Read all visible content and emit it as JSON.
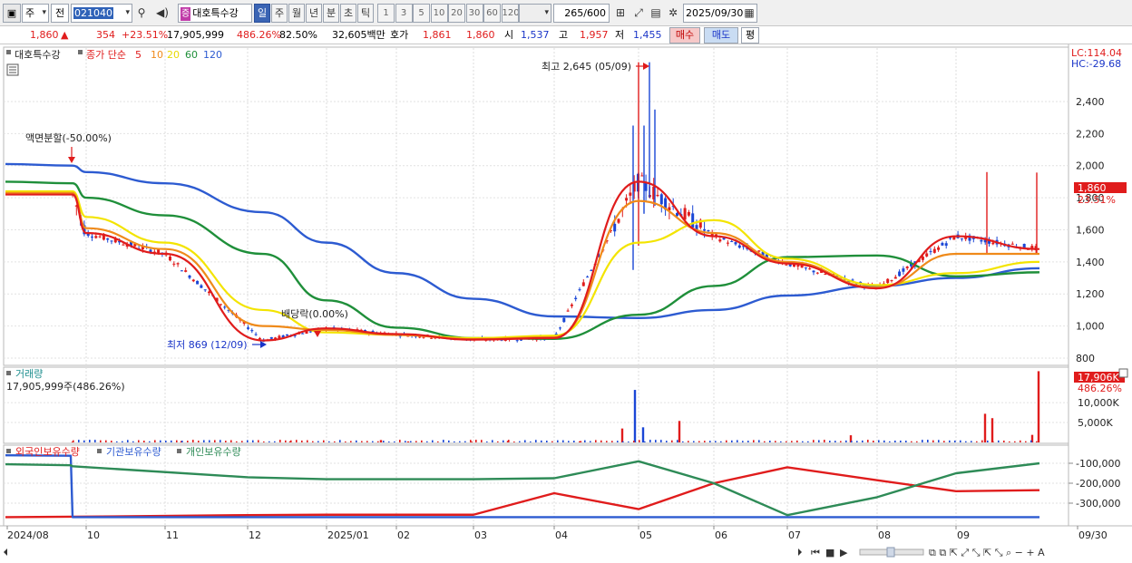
{
  "toolbar": {
    "market_label": "주",
    "scope_label": "전",
    "stock_code": "021040",
    "stock_tag": "증",
    "stock_name": "대호특수강",
    "periods": [
      "일",
      "주",
      "월",
      "년",
      "분",
      "초",
      "틱"
    ],
    "active_period": "일",
    "intervals": [
      "1",
      "3",
      "5",
      "10",
      "20",
      "30",
      "60",
      "120"
    ],
    "bar_count": "265",
    "bar_total": "/600",
    "date": "2025/09/30"
  },
  "quote": {
    "price": "1,860",
    "change": "354",
    "change_rate": "+23.51%",
    "volume": "17,905,999",
    "volume_rate": "486.26%",
    "strength": "82.50%",
    "amount": "32,605백만",
    "ask_label": "호가",
    "ask": "1,861",
    "bid": "1,860",
    "open_label": "시",
    "open": "1,537",
    "high_label": "고",
    "high": "1,957",
    "low_label": "저",
    "low": "1,455",
    "buy_button": "매수",
    "sell_button": "매도",
    "eval_button": "평"
  },
  "price_panel": {
    "title": "대호특수강",
    "ma_label": "종가 단순",
    "ma_periods": [
      "5",
      "10",
      "20",
      "60",
      "120"
    ],
    "ma_colors": [
      "#e01c1c",
      "#ef8a1a",
      "#f3e400",
      "#1f8f3a",
      "#2d5bd1"
    ],
    "up_color": "#e01c1c",
    "down_color": "#1a46d6",
    "lc_label": "LC:114.04",
    "hc_label": "HC:-29.68",
    "last_price_tag": "1,860",
    "last_rate_tag": "23.51%",
    "annotations": {
      "split": "액면분할(-50.00%)",
      "dividend": "배당락(0.00%)",
      "high": "최고 2,645 (05/09)",
      "low": "최저 869 (12/09)"
    }
  },
  "volume_panel": {
    "title": "거래량",
    "value_label": "17,905,999주(486.26%)",
    "last_tag": "17,906K",
    "last_rate_tag": "486.26%",
    "ticks": [
      "10,000K",
      "5,000K"
    ]
  },
  "holding_panel": {
    "labels": [
      "외국인보유수량",
      "기관보유수량",
      "개인보유수량"
    ],
    "colors": [
      "#e01c1c",
      "#2d5bd1",
      "#2e8b57"
    ],
    "ticks": [
      "-100,000",
      "-200,000",
      "-300,000"
    ]
  },
  "x_axis": {
    "labels": [
      "2024/08",
      "10",
      "11",
      "12",
      "2025/01",
      "02",
      "03",
      "04",
      "05",
      "06",
      "07",
      "08",
      "09",
      "09/30"
    ]
  },
  "chart_data": [
    {
      "type": "line",
      "title": "대호특수강",
      "ylim": [
        800,
        2645
      ],
      "y_ticks": [
        800,
        1000,
        1200,
        1400,
        1600,
        1800,
        2000,
        2200,
        2400
      ],
      "x": [
        "2024/09",
        "2024/10",
        "2024/11",
        "2024/12",
        "2025/01",
        "2025/02",
        "2025/03",
        "2025/04",
        "2025/05",
        "2025/06",
        "2025/07",
        "2025/08",
        "2025/09",
        "09/30"
      ],
      "series": [
        {
          "name": "5",
          "values": [
            1820,
            1580,
            1450,
            910,
            985,
            950,
            915,
            925,
            1900,
            1560,
            1390,
            1235,
            1560,
            1480
          ]
        },
        {
          "name": "10",
          "values": [
            1830,
            1610,
            1480,
            1000,
            975,
            945,
            918,
            930,
            1780,
            1580,
            1400,
            1240,
            1450,
            1450
          ]
        },
        {
          "name": "20",
          "values": [
            1840,
            1680,
            1520,
            1100,
            960,
            945,
            925,
            940,
            1520,
            1660,
            1420,
            1255,
            1330,
            1400
          ]
        },
        {
          "name": "60",
          "values": [
            1890,
            1800,
            1690,
            1450,
            1160,
            990,
            925,
            920,
            1070,
            1250,
            1430,
            1440,
            1310,
            1335
          ]
        },
        {
          "name": "120",
          "values": [
            2000,
            1960,
            1890,
            1710,
            1520,
            1330,
            1170,
            1060,
            1050,
            1100,
            1190,
            1250,
            1300,
            1360
          ]
        }
      ],
      "annotations": [
        {
          "x": "2024/09",
          "text": "액면분할(-50.00%)"
        },
        {
          "x": "2024/12",
          "text": "배당락(0.00%)"
        },
        {
          "x": "2025/05",
          "text": "최고 2,645 (05/09)",
          "value": 2645
        },
        {
          "x": "2024/12",
          "text": "최저 869 (12/09)",
          "value": 869
        }
      ]
    },
    {
      "type": "bar",
      "title": "거래량",
      "categories": [
        "2024/09",
        "2024/10",
        "2024/11",
        "2024/12",
        "2025/01",
        "2025/02",
        "2025/03",
        "2025/04",
        "05/02",
        "05/07",
        "05/09",
        "05/13",
        "07/03",
        "09/05",
        "09/08",
        "09/29",
        "09/30"
      ],
      "values": [
        200,
        350,
        300,
        600,
        250,
        200,
        400,
        350,
        3500,
        13200,
        3800,
        5400,
        1800,
        7200,
        6100,
        1900,
        17906
      ],
      "ylim": [
        0,
        18000
      ],
      "y_ticks": [
        5000,
        10000
      ],
      "unit": "K"
    },
    {
      "type": "line",
      "title": "외국인보유수량 / 기관보유수량 / 개인보유수량",
      "ylim": [
        -380000,
        -40000
      ],
      "y_ticks": [
        -100000,
        -200000,
        -300000
      ],
      "x": [
        "2024/08",
        "2024/09",
        "2024/10",
        "2024/12",
        "2025/01",
        "2025/03",
        "2025/04",
        "2025/05",
        "2025/06",
        "2025/07",
        "2025/08",
        "2025/09",
        "09/30"
      ],
      "series": [
        {
          "name": "외국인보유수량",
          "values": [
            -370000,
            -368000,
            -368000,
            -360000,
            -358000,
            -358000,
            -250000,
            -330000,
            -200000,
            -120000,
            -185000,
            -240000,
            -235000
          ]
        },
        {
          "name": "기관보유수량",
          "values": [
            -60000,
            -62000,
            -370000,
            -370000,
            -370000,
            -370000,
            -370000,
            -370000,
            -370000,
            -370000,
            -370000,
            -370000,
            -370000
          ]
        },
        {
          "name": "개인보유수량",
          "values": [
            -105000,
            -110000,
            -115000,
            -170000,
            -180000,
            -180000,
            -175000,
            -90000,
            -200000,
            -360000,
            -270000,
            -150000,
            -100000
          ]
        }
      ]
    }
  ]
}
